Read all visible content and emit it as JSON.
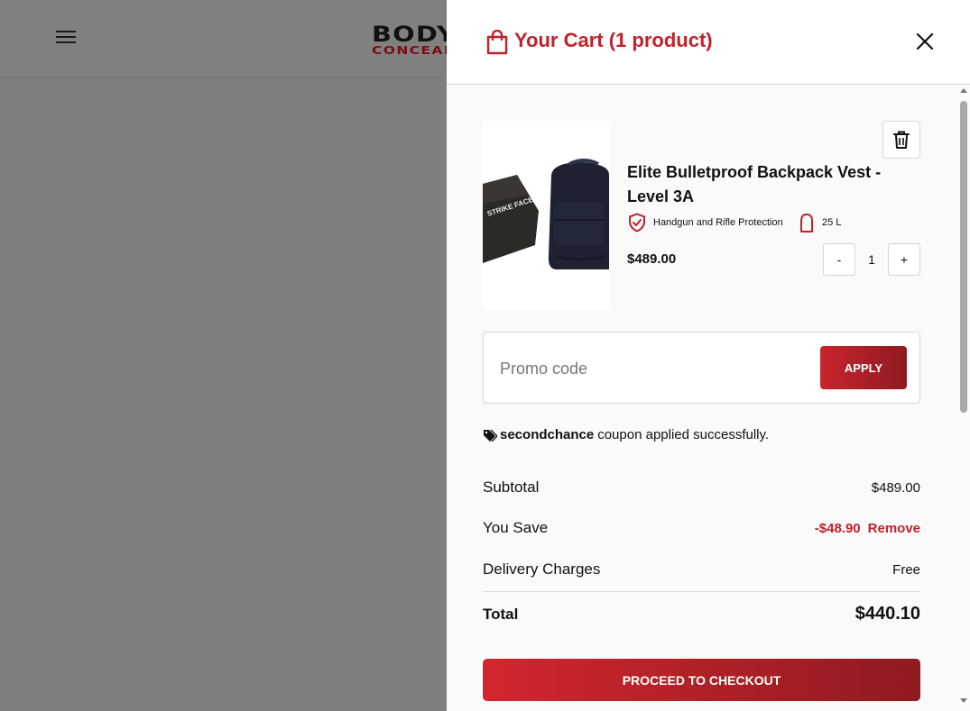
{
  "background": {
    "logo_top": "BODY",
    "logo_bottom": "CONCEALED"
  },
  "cart": {
    "title": "Your Cart (1 product)",
    "item": {
      "name": "Elite Bulletproof Backpack Vest - Level 3A",
      "image_label": "STRIKE FACE",
      "feature_1": "Handgun and Rifle Protection",
      "feature_2": "25 L",
      "price": "$489.00",
      "qty_minus": "-",
      "qty_plus": "+",
      "quantity": "1"
    },
    "promo": {
      "placeholder": "Promo code",
      "apply_label": "APPLY"
    },
    "coupon": {
      "code": "secondchance",
      "message": "coupon applied successfully."
    },
    "summary": {
      "subtotal_label": "Subtotal",
      "subtotal_value": "$489.00",
      "save_label": "You Save",
      "save_value": "-$48.90",
      "remove_label": "Remove",
      "delivery_label": "Delivery Charges",
      "delivery_value": "Free",
      "total_label": "Total",
      "total_value": "$440.10"
    },
    "checkout_label": "PROCEED TO CHECKOUT"
  },
  "colors": {
    "accent": "#c0222b",
    "accent_dark": "#8e1b20",
    "overlay": "#7f7f7f"
  }
}
